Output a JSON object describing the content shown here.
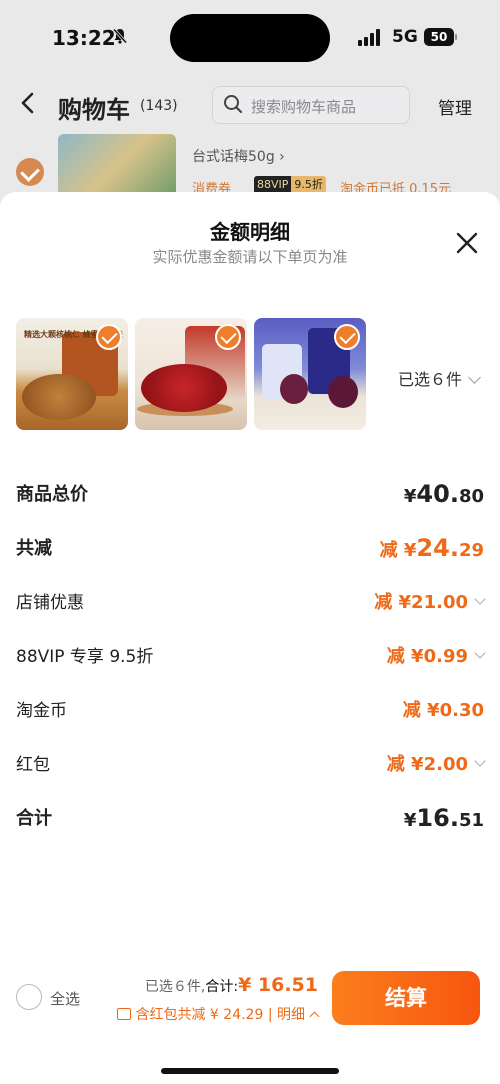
{
  "status": {
    "time": "13:22",
    "network": "5G",
    "battery": "50"
  },
  "header": {
    "title": "购物车",
    "count": "(143)",
    "search_placeholder": "搜索购物车商品",
    "manage": "管理"
  },
  "cart_row": {
    "name": "台式话梅50g ›",
    "coupon_tag": "消费券",
    "vip_a": "88VIP",
    "vip_b": "9.5折",
    "coin": "淘金币已抵 0.15元"
  },
  "sheet": {
    "title": "金额明细",
    "subtitle": "实际优惠金额请以下单页为准",
    "products": [
      {
        "name": "精选大颗核桃仁 蜂蜜琥珀味"
      },
      {
        "name": "红枣"
      },
      {
        "name": "西梅"
      }
    ],
    "selected_count": "已选６件",
    "rows": [
      {
        "label": "商品总价",
        "prefix": "¥",
        "big": "40.",
        "small": "80"
      },
      {
        "label": "共减",
        "prefix": "减 ¥",
        "big": "24.",
        "small": "29"
      },
      {
        "label": "店铺优惠",
        "prefix": "减 ¥",
        "big": "21.",
        "small": "00"
      },
      {
        "label": "88VIP 专享 9.5折",
        "prefix": "减 ¥",
        "big": "0.",
        "small": "99"
      },
      {
        "label": "淘金币",
        "prefix": "减 ¥",
        "big": "0.",
        "small": "30"
      },
      {
        "label": "红包",
        "prefix": "减 ¥",
        "big": "2.",
        "small": "00"
      },
      {
        "label": "合计",
        "prefix": "¥",
        "big": "16.",
        "small": "51"
      }
    ]
  },
  "bottom_bar": {
    "select_all": "全选",
    "selected": "已选６件,",
    "total_label": "合计:",
    "total_amount": "¥ 16.51",
    "coupon_text": "含红包共减 ¥ 24.29 | 明细",
    "checkout": "结算"
  },
  "colors": {
    "accent": "#ee6a18",
    "checkout_start": "#fb7e1c",
    "checkout_end": "#f6560f"
  }
}
